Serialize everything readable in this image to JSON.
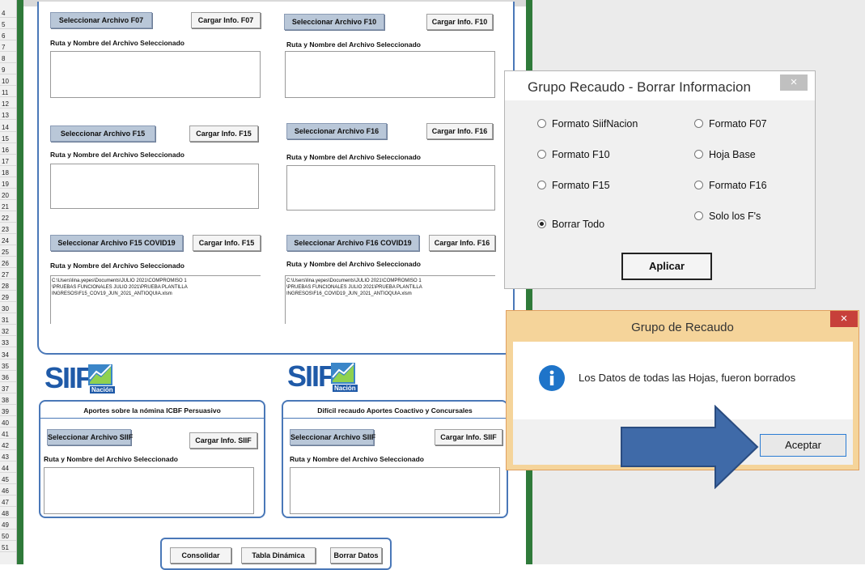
{
  "rows": [
    "4",
    "5",
    "6",
    "7",
    "8",
    "9",
    "10",
    "11",
    "12",
    "13",
    "14",
    "15",
    "16",
    "17",
    "18",
    "19",
    "20",
    "21",
    "22",
    "23",
    "24",
    "25",
    "26",
    "27",
    "28",
    "29",
    "30",
    "31",
    "32",
    "33",
    "34",
    "35",
    "36",
    "37",
    "38",
    "39",
    "40",
    "41",
    "42",
    "43",
    "44",
    "45",
    "46",
    "47",
    "48",
    "49",
    "50",
    "51"
  ],
  "panel": {
    "f07": {
      "select": "Seleccionar Archivo F07",
      "load": "Cargar Info. F07",
      "label": "Ruta y Nombre del Archivo Seleccionado"
    },
    "f10": {
      "select": "Seleccionar Archivo F10",
      "load": "Cargar Info. F10",
      "label": "Ruta y Nombre del Archivo Seleccionado"
    },
    "f15": {
      "select": "Seleccionar Archivo F15",
      "load": "Cargar Info. F15",
      "label": "Ruta y Nombre del Archivo Seleccionado"
    },
    "f16": {
      "select": "Seleccionar Archivo F16",
      "load": "Cargar Info. F16",
      "label": "Ruta y Nombre del Archivo Seleccionado"
    },
    "f15c": {
      "select": "Seleccionar Archivo F15 COVID19",
      "load": "Cargar Info. F15",
      "label": "Ruta y Nombre del Archivo Seleccionado",
      "path1": "C:\\Users\\lina.yepes\\Documents\\JULIO 2021\\COMPROMISO 1",
      "path2": "\\PRUEBAS FUNCIONALES JULIO 2021\\PRUEBA PLANTILLA",
      "path3": "INGRESOS\\F15_COV19_JUN_2021_ANTIOQUIA.xlsm"
    },
    "f16c": {
      "select": "Seleccionar Archivo F16 COVID19",
      "load": "Cargar Info. F16",
      "label": "Ruta y Nombre del Archivo Seleccionado",
      "path1": "C:\\Users\\lina.yepes\\Documents\\JULIO 2021\\COMPROMISO 1",
      "path2": "\\PRUEBAS FUNCIONALES JULIO 2021\\PRUEBA PLANTILLA",
      "path3": "INGRESOS\\F16_COVID19_JUN_2021_ANTIOQUIA.xlsm"
    }
  },
  "siif": {
    "logo": "SIIF",
    "sub": "Nación"
  },
  "icbf": {
    "title": "Aportes sobre la nómina ICBF Persuasivo",
    "select": "Seleccionar Archivo SIIF",
    "load": "Cargar Info. SIIF",
    "label": "Ruta y Nombre del Archivo Seleccionado"
  },
  "dificil": {
    "title": "Difícil recaudo Aportes Coactivo y Concursales",
    "select": "Seleccionar Archivo SIIF",
    "load": "Cargar Info. SIIF",
    "label": "Ruta y Nombre del Archivo Seleccionado"
  },
  "bottom": {
    "consolidar": "Consolidar",
    "tabla": "Tabla Dinámica",
    "borrar": "Borrar Datos"
  },
  "borrar_dialog": {
    "title": "Grupo Recaudo - Borrar Informacion",
    "close": "×",
    "options": {
      "siifnacion": "Formato SiifNacion",
      "f07": "Formato F07",
      "f10": "Formato F10",
      "hoja": "Hoja Base",
      "f15": "Formato F15",
      "f16": "Formato F16",
      "todo": "Borrar Todo",
      "solo": "Solo los F's"
    },
    "selected": "Borrar Todo",
    "apply": "Aplicar"
  },
  "msg_dialog": {
    "title": "Grupo de Recaudo",
    "close": "×",
    "message": "Los Datos de todas las Hojas, fueron borrados",
    "ok": "Aceptar"
  },
  "colors": {
    "panel_border": "#4a78b8",
    "excel_green": "#2f7a3a",
    "close_red": "#c7403a",
    "info_blue": "#1e74c9",
    "arrow_blue": "#3f6aa8"
  }
}
